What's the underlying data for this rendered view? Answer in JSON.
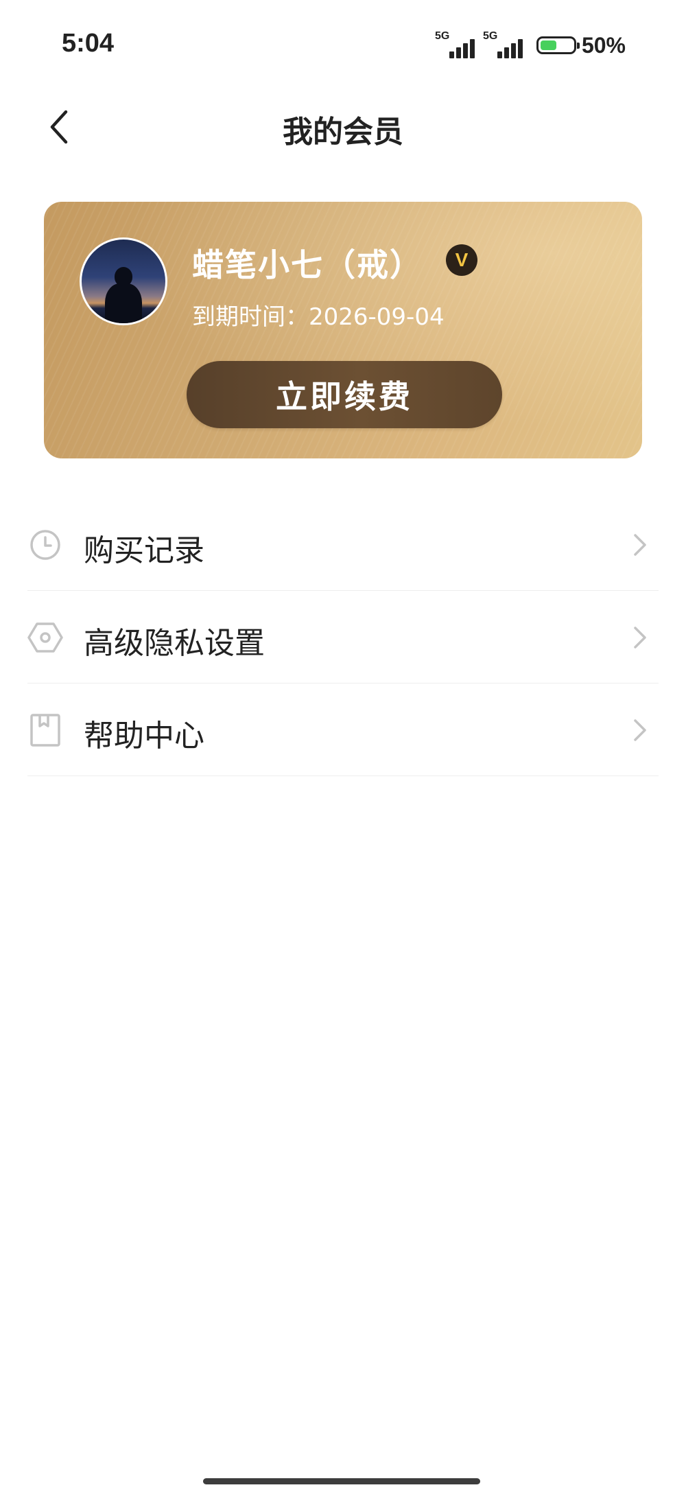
{
  "status_bar": {
    "time": "5:04",
    "signal1_label": "5G",
    "signal2_label": "5G",
    "battery_text": "50%",
    "battery_level": 0.5,
    "battery_color": "#47d05c"
  },
  "nav": {
    "title": "我的会员"
  },
  "member_card": {
    "username": "蜡笔小七（戒）",
    "vip_badge": "V",
    "expire_label": "到期时间：",
    "expire_date": "2026-09-04",
    "renew_button": "立即续费",
    "accent_color": "#d0aa72",
    "button_color": "#5e452c"
  },
  "menu": {
    "items": [
      {
        "icon": "clock-icon",
        "label": "购买记录"
      },
      {
        "icon": "hexagon-settings-icon",
        "label": "高级隐私设置"
      },
      {
        "icon": "bookmark-book-icon",
        "label": "帮助中心"
      }
    ]
  }
}
